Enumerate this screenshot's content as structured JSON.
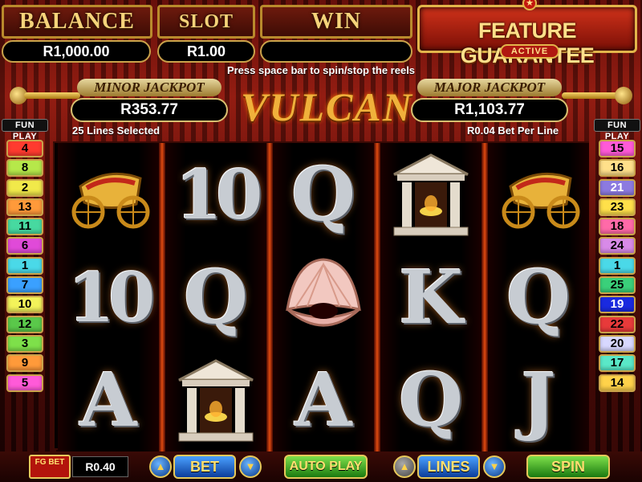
{
  "meters": {
    "balance_label": "BALANCE",
    "balance_value": "R1,000.00",
    "slot_bet_label": "SLOT BET",
    "slot_bet_value": "R1.00",
    "win_label": "WIN",
    "win_value": ""
  },
  "feature": {
    "title": "FEATURE GUARANTEE",
    "status": "ACTIVE"
  },
  "instruction": "Press space bar to spin/stop the reels",
  "jackpots": {
    "minor_label": "MINOR JACKPOT",
    "minor_value": "R353.77",
    "major_label": "MAJOR JACKPOT",
    "major_value": "R1,103.77"
  },
  "logo": "VULCAN",
  "lines_selected": "25 Lines Selected",
  "bet_per_line": "R0.04 Bet Per Line",
  "fun_play_left": "FUN PLAY",
  "fun_play_right": "FUN PLAY",
  "left_lines": [
    {
      "n": "4",
      "color": "#ff3b2f"
    },
    {
      "n": "8",
      "color": "#b6e84a"
    },
    {
      "n": "2",
      "color": "#f1e94a"
    },
    {
      "n": "13",
      "color": "#ff9a3a"
    },
    {
      "n": "11",
      "color": "#47d9a0"
    },
    {
      "n": "6",
      "color": "#e04ad8"
    },
    {
      "n": "1",
      "color": "#4ad9e8"
    },
    {
      "n": "7",
      "color": "#3aa0ff"
    },
    {
      "n": "10",
      "color": "#f3f35a"
    },
    {
      "n": "12",
      "color": "#5ac84a"
    },
    {
      "n": "3",
      "color": "#7ee04a"
    },
    {
      "n": "9",
      "color": "#ff9a3a"
    },
    {
      "n": "5",
      "color": "#ff5ad8"
    }
  ],
  "right_lines": [
    {
      "n": "15",
      "color": "#ff5ad8"
    },
    {
      "n": "16",
      "color": "#ffe08a"
    },
    {
      "n": "21",
      "color": "#8c7ae0"
    },
    {
      "n": "23",
      "color": "#ffe04a"
    },
    {
      "n": "18",
      "color": "#ff6aa8"
    },
    {
      "n": "24",
      "color": "#d88ae8"
    },
    {
      "n": "1",
      "color": "#4ad9e8"
    },
    {
      "n": "25",
      "color": "#3ad07a"
    },
    {
      "n": "19",
      "color": "#1a2ae0"
    },
    {
      "n": "22",
      "color": "#e83a3a"
    },
    {
      "n": "20",
      "color": "#d8d8ff"
    },
    {
      "n": "17",
      "color": "#5ae8c8"
    },
    {
      "n": "14",
      "color": "#ffd24a"
    }
  ],
  "reels": [
    [
      "chariot-symbol",
      "10",
      "A"
    ],
    [
      "10",
      "Q",
      "temple-symbol"
    ],
    [
      "Q",
      "shell-symbol",
      "A"
    ],
    [
      "temple-symbol",
      "K",
      "Q"
    ],
    [
      "chariot-symbol",
      "Q",
      "J"
    ]
  ],
  "bottom": {
    "fg_bet_label": "FG BET",
    "fg_bet_value": "R0.40",
    "bet_label": "BET",
    "auto_play_label": "AUTO PLAY",
    "lines_label": "LINES",
    "spin_label": "SPIN"
  }
}
